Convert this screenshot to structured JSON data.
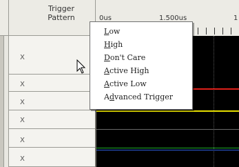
{
  "header": {
    "trigger_pattern_label": "Trigger\nPattern"
  },
  "ruler": {
    "labels": [
      "0us",
      "1.500us",
      "1"
    ]
  },
  "rows": [
    {
      "pattern": "X"
    },
    {
      "pattern": "X"
    },
    {
      "pattern": "X"
    },
    {
      "pattern": "X"
    },
    {
      "pattern": "X"
    },
    {
      "pattern": "X"
    }
  ],
  "context_menu": {
    "items": [
      {
        "first": "L",
        "rest": "ow"
      },
      {
        "first": "H",
        "rest": "igh"
      },
      {
        "first": "D",
        "rest": "on't Care"
      },
      {
        "first": "A",
        "rest": "ctive High"
      },
      {
        "first": "A",
        "rest": "ctive Low"
      },
      {
        "first": "Ad",
        "rest": "vanced Trigger",
        "underline_index": 1
      }
    ]
  },
  "colors": {
    "waveform_bg": "#000000",
    "signal_red": "#e0201a",
    "signal_yellow": "#e7e000",
    "signal_green": "#1fb02b",
    "signal_blue": "#2e5fe0",
    "signal_gray": "#6a6a6a"
  }
}
